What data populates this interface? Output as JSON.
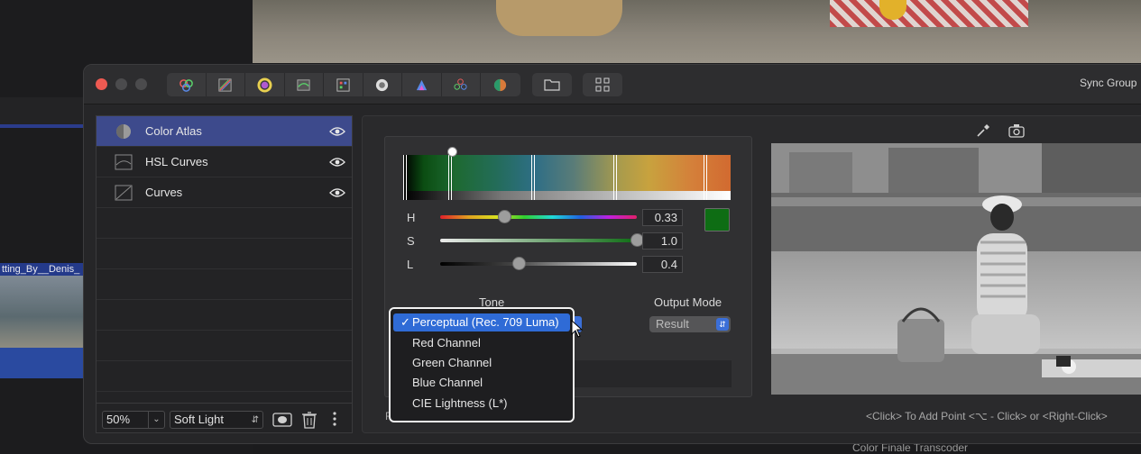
{
  "background": {
    "clip_label": "tting_By__Denis_",
    "bottom_text": "Color Finale Transcoder"
  },
  "titlebar": {
    "sync_label": "Sync Group"
  },
  "layers": {
    "items": [
      {
        "label": "Color Atlas",
        "icon": "color-atlas-icon",
        "selected": true
      },
      {
        "label": "HSL Curves",
        "icon": "hsl-curves-icon",
        "selected": false
      },
      {
        "label": "Curves",
        "icon": "curves-icon",
        "selected": false
      }
    ],
    "opacity_value": "50%",
    "blend_value": "Soft Light"
  },
  "atlas": {
    "h_label": "H",
    "h_value": "0.33",
    "s_label": "S",
    "s_value": "1.0",
    "l_label": "L",
    "l_value": "0.4",
    "h_fraction": 0.33,
    "s_fraction": 1.0,
    "l_fraction": 0.4,
    "swatch_color": "#0e6d14",
    "tone_label": "Tone",
    "output_label": "Output Mode",
    "output_value": "Result",
    "footer_prefix": "R"
  },
  "tone_menu": {
    "items": [
      {
        "label": "Perceptual (Rec. 709 Luma)",
        "checked": true
      },
      {
        "label": "Red Channel",
        "checked": false
      },
      {
        "label": "Green Channel",
        "checked": false
      },
      {
        "label": "Blue Channel",
        "checked": false
      },
      {
        "label": "CIE Lightness (L*)",
        "checked": false
      }
    ],
    "check_glyph": "✓"
  },
  "preview": {
    "hint": "<Click> To Add Point <⌥ - Click> or <Right-Click>"
  },
  "colors": {
    "accent": "#2f6bd6",
    "selected_layer": "#3d4a8c",
    "close": "#ee5a52"
  }
}
